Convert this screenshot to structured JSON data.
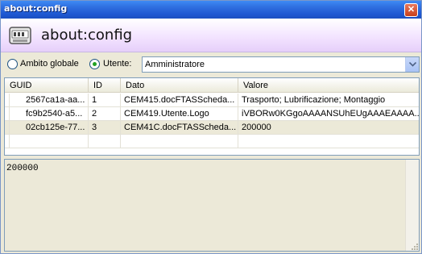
{
  "window": {
    "title": "about:config",
    "close_symbol": "✕"
  },
  "header": {
    "title": "about:config",
    "icon": "config-settings-icon"
  },
  "scope": {
    "global_label": "Ambito globale",
    "user_label": "Utente:",
    "selected": "user",
    "user_value": "Amministratore"
  },
  "grid": {
    "columns": [
      "GUID",
      "ID",
      "Dato",
      "Valore"
    ],
    "rows": [
      {
        "guid": "2567ca1a-aa...",
        "id": "1",
        "dato": "CEM415.docFTASScheda...",
        "valore": "Trasporto; Lubrificazione; Montaggio"
      },
      {
        "guid": "fc9b2540-a5...",
        "id": "2",
        "dato": "CEM419.Utente.Logo",
        "valore": "iVBORw0KGgoAAAANSUhEUgAAAEAAAA..."
      },
      {
        "guid": "02cb125e-77...",
        "id": "3",
        "dato": "CEM41C.docFTASScheda...",
        "valore": "200000"
      }
    ],
    "selected_row": 2
  },
  "editor": {
    "value": "200000"
  },
  "colors": {
    "titlebar": "#2f6fe0",
    "selection": "#ece9d8",
    "radio_dot": "#21a121"
  }
}
